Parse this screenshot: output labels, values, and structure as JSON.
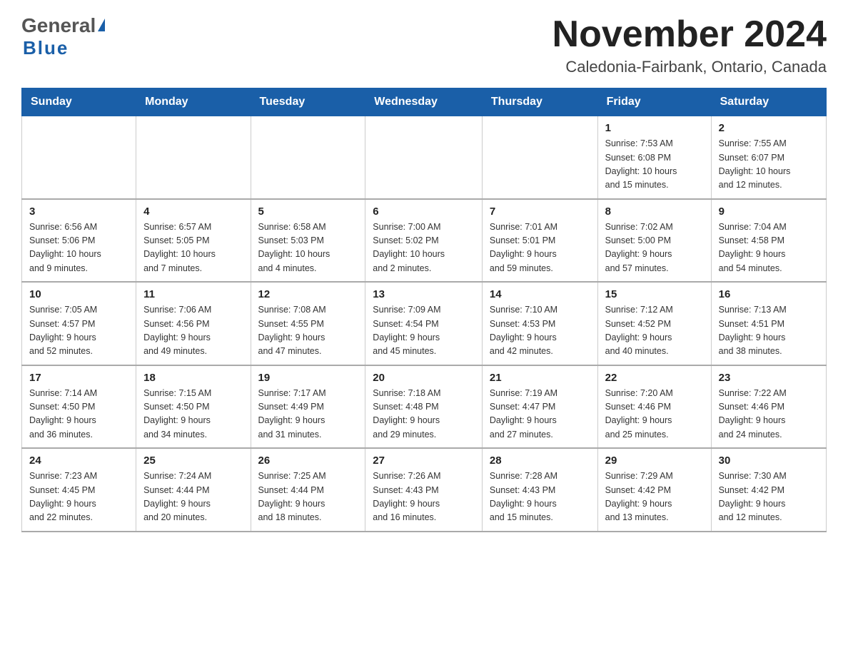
{
  "header": {
    "logo_line1": "General",
    "logo_triangle": "▶",
    "logo_line2": "Blue",
    "month_title": "November 2024",
    "location": "Caledonia-Fairbank, Ontario, Canada"
  },
  "weekdays": [
    "Sunday",
    "Monday",
    "Tuesday",
    "Wednesday",
    "Thursday",
    "Friday",
    "Saturday"
  ],
  "weeks": [
    [
      {
        "day": "",
        "info": ""
      },
      {
        "day": "",
        "info": ""
      },
      {
        "day": "",
        "info": ""
      },
      {
        "day": "",
        "info": ""
      },
      {
        "day": "",
        "info": ""
      },
      {
        "day": "1",
        "info": "Sunrise: 7:53 AM\nSunset: 6:08 PM\nDaylight: 10 hours\nand 15 minutes."
      },
      {
        "day": "2",
        "info": "Sunrise: 7:55 AM\nSunset: 6:07 PM\nDaylight: 10 hours\nand 12 minutes."
      }
    ],
    [
      {
        "day": "3",
        "info": "Sunrise: 6:56 AM\nSunset: 5:06 PM\nDaylight: 10 hours\nand 9 minutes."
      },
      {
        "day": "4",
        "info": "Sunrise: 6:57 AM\nSunset: 5:05 PM\nDaylight: 10 hours\nand 7 minutes."
      },
      {
        "day": "5",
        "info": "Sunrise: 6:58 AM\nSunset: 5:03 PM\nDaylight: 10 hours\nand 4 minutes."
      },
      {
        "day": "6",
        "info": "Sunrise: 7:00 AM\nSunset: 5:02 PM\nDaylight: 10 hours\nand 2 minutes."
      },
      {
        "day": "7",
        "info": "Sunrise: 7:01 AM\nSunset: 5:01 PM\nDaylight: 9 hours\nand 59 minutes."
      },
      {
        "day": "8",
        "info": "Sunrise: 7:02 AM\nSunset: 5:00 PM\nDaylight: 9 hours\nand 57 minutes."
      },
      {
        "day": "9",
        "info": "Sunrise: 7:04 AM\nSunset: 4:58 PM\nDaylight: 9 hours\nand 54 minutes."
      }
    ],
    [
      {
        "day": "10",
        "info": "Sunrise: 7:05 AM\nSunset: 4:57 PM\nDaylight: 9 hours\nand 52 minutes."
      },
      {
        "day": "11",
        "info": "Sunrise: 7:06 AM\nSunset: 4:56 PM\nDaylight: 9 hours\nand 49 minutes."
      },
      {
        "day": "12",
        "info": "Sunrise: 7:08 AM\nSunset: 4:55 PM\nDaylight: 9 hours\nand 47 minutes."
      },
      {
        "day": "13",
        "info": "Sunrise: 7:09 AM\nSunset: 4:54 PM\nDaylight: 9 hours\nand 45 minutes."
      },
      {
        "day": "14",
        "info": "Sunrise: 7:10 AM\nSunset: 4:53 PM\nDaylight: 9 hours\nand 42 minutes."
      },
      {
        "day": "15",
        "info": "Sunrise: 7:12 AM\nSunset: 4:52 PM\nDaylight: 9 hours\nand 40 minutes."
      },
      {
        "day": "16",
        "info": "Sunrise: 7:13 AM\nSunset: 4:51 PM\nDaylight: 9 hours\nand 38 minutes."
      }
    ],
    [
      {
        "day": "17",
        "info": "Sunrise: 7:14 AM\nSunset: 4:50 PM\nDaylight: 9 hours\nand 36 minutes."
      },
      {
        "day": "18",
        "info": "Sunrise: 7:15 AM\nSunset: 4:50 PM\nDaylight: 9 hours\nand 34 minutes."
      },
      {
        "day": "19",
        "info": "Sunrise: 7:17 AM\nSunset: 4:49 PM\nDaylight: 9 hours\nand 31 minutes."
      },
      {
        "day": "20",
        "info": "Sunrise: 7:18 AM\nSunset: 4:48 PM\nDaylight: 9 hours\nand 29 minutes."
      },
      {
        "day": "21",
        "info": "Sunrise: 7:19 AM\nSunset: 4:47 PM\nDaylight: 9 hours\nand 27 minutes."
      },
      {
        "day": "22",
        "info": "Sunrise: 7:20 AM\nSunset: 4:46 PM\nDaylight: 9 hours\nand 25 minutes."
      },
      {
        "day": "23",
        "info": "Sunrise: 7:22 AM\nSunset: 4:46 PM\nDaylight: 9 hours\nand 24 minutes."
      }
    ],
    [
      {
        "day": "24",
        "info": "Sunrise: 7:23 AM\nSunset: 4:45 PM\nDaylight: 9 hours\nand 22 minutes."
      },
      {
        "day": "25",
        "info": "Sunrise: 7:24 AM\nSunset: 4:44 PM\nDaylight: 9 hours\nand 20 minutes."
      },
      {
        "day": "26",
        "info": "Sunrise: 7:25 AM\nSunset: 4:44 PM\nDaylight: 9 hours\nand 18 minutes."
      },
      {
        "day": "27",
        "info": "Sunrise: 7:26 AM\nSunset: 4:43 PM\nDaylight: 9 hours\nand 16 minutes."
      },
      {
        "day": "28",
        "info": "Sunrise: 7:28 AM\nSunset: 4:43 PM\nDaylight: 9 hours\nand 15 minutes."
      },
      {
        "day": "29",
        "info": "Sunrise: 7:29 AM\nSunset: 4:42 PM\nDaylight: 9 hours\nand 13 minutes."
      },
      {
        "day": "30",
        "info": "Sunrise: 7:30 AM\nSunset: 4:42 PM\nDaylight: 9 hours\nand 12 minutes."
      }
    ]
  ]
}
